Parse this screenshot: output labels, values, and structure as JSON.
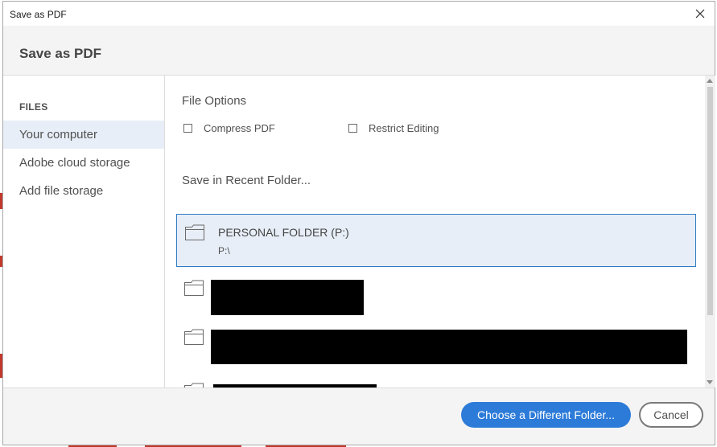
{
  "window": {
    "title": "Save as PDF"
  },
  "header": {
    "title": "Save as PDF"
  },
  "sidebar": {
    "heading": "FILES",
    "items": [
      {
        "label": "Your computer",
        "selected": true
      },
      {
        "label": "Adobe cloud storage",
        "selected": false
      },
      {
        "label": "Add file storage",
        "selected": false
      }
    ]
  },
  "file_options": {
    "title": "File Options",
    "compress_pdf": {
      "label": "Compress PDF",
      "checked": false
    },
    "restrict_editing": {
      "label": "Restrict Editing",
      "checked": false
    }
  },
  "recent": {
    "title": "Save in Recent Folder...",
    "folders": [
      {
        "name": "PERSONAL FOLDER (P:)",
        "path": "P:\\",
        "selected": true
      }
    ]
  },
  "footer": {
    "choose_folder_label": "Choose a Different Folder...",
    "cancel_label": "Cancel"
  },
  "colors": {
    "accent": "#2d7bd8",
    "selection_bg": "#e7eef7",
    "selection_border": "#2d7bc4"
  }
}
